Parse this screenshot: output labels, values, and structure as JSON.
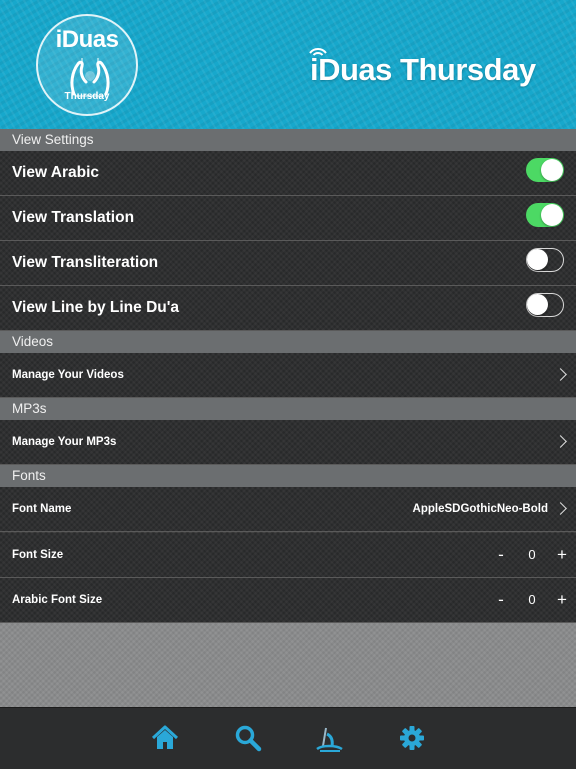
{
  "header": {
    "logo_title": "iDuas",
    "logo_day": "Thursday",
    "app_title": "iDuas Thursday",
    "accent_color": "#17a8cc"
  },
  "sections": {
    "view_settings": "View Settings",
    "videos": "Videos",
    "mp3s": "MP3s",
    "fonts": "Fonts"
  },
  "view_settings": [
    {
      "label": "View Arabic",
      "on": true
    },
    {
      "label": "View Translation",
      "on": true
    },
    {
      "label": "View Transliteration",
      "on": false
    },
    {
      "label": "View Line by Line Du'a",
      "on": false
    }
  ],
  "videos": {
    "manage_label": "Manage Your Videos"
  },
  "mp3s": {
    "manage_label": "Manage Your MP3s"
  },
  "fonts": {
    "font_name_label": "Font Name",
    "font_name_value": "AppleSDGothicNeo-Bold",
    "font_size_label": "Font Size",
    "font_size_value": "0",
    "arabic_font_size_label": "Arabic Font Size",
    "arabic_font_size_value": "0",
    "minus": "-",
    "plus": "+"
  },
  "tabbar": {
    "icons": [
      "home-icon",
      "search-icon",
      "prayer-icon",
      "gear-icon"
    ],
    "icon_color": "#2aa8d8"
  },
  "toggle_on_color": "#4cd964"
}
